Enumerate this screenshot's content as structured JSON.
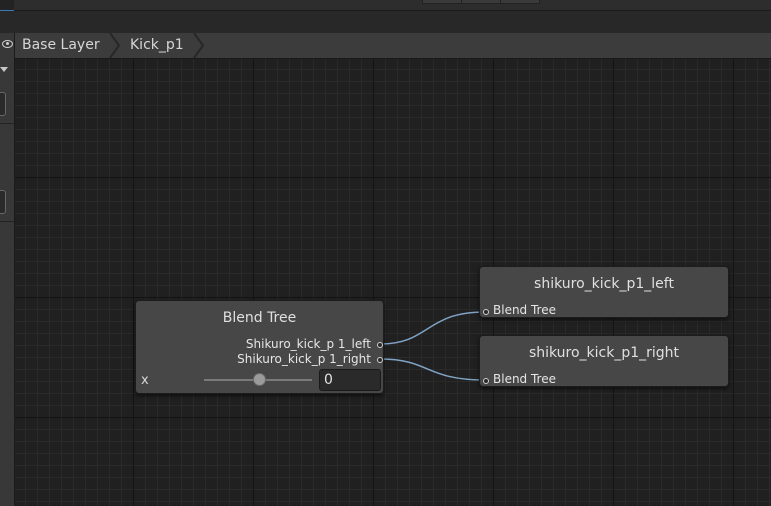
{
  "breadcrumb": {
    "items": [
      {
        "label": "Base Layer"
      },
      {
        "label": "Kick_p1"
      }
    ]
  },
  "blend_tree": {
    "title": "Blend Tree",
    "outputs": [
      {
        "label": "Shikuro_kick_p 1_left"
      },
      {
        "label": "Shikuro_kick_p 1_right"
      }
    ],
    "parameter": {
      "name": "x",
      "value": "0",
      "slider_fraction": 0.5
    }
  },
  "child_nodes": [
    {
      "title": "shikuro_kick_p1_left",
      "input_label": "Blend Tree"
    },
    {
      "title": "shikuro_kick_p1_right",
      "input_label": "Blend Tree"
    }
  ],
  "colors": {
    "background": "#202020",
    "node": "#474747",
    "wire": "#7fa3c4",
    "accent": "#3a79bb"
  },
  "icons": {
    "visibility": "eye-icon",
    "breadcrumb_separator": "chevron-right-icon",
    "dropdown": "chevron-down-icon"
  }
}
